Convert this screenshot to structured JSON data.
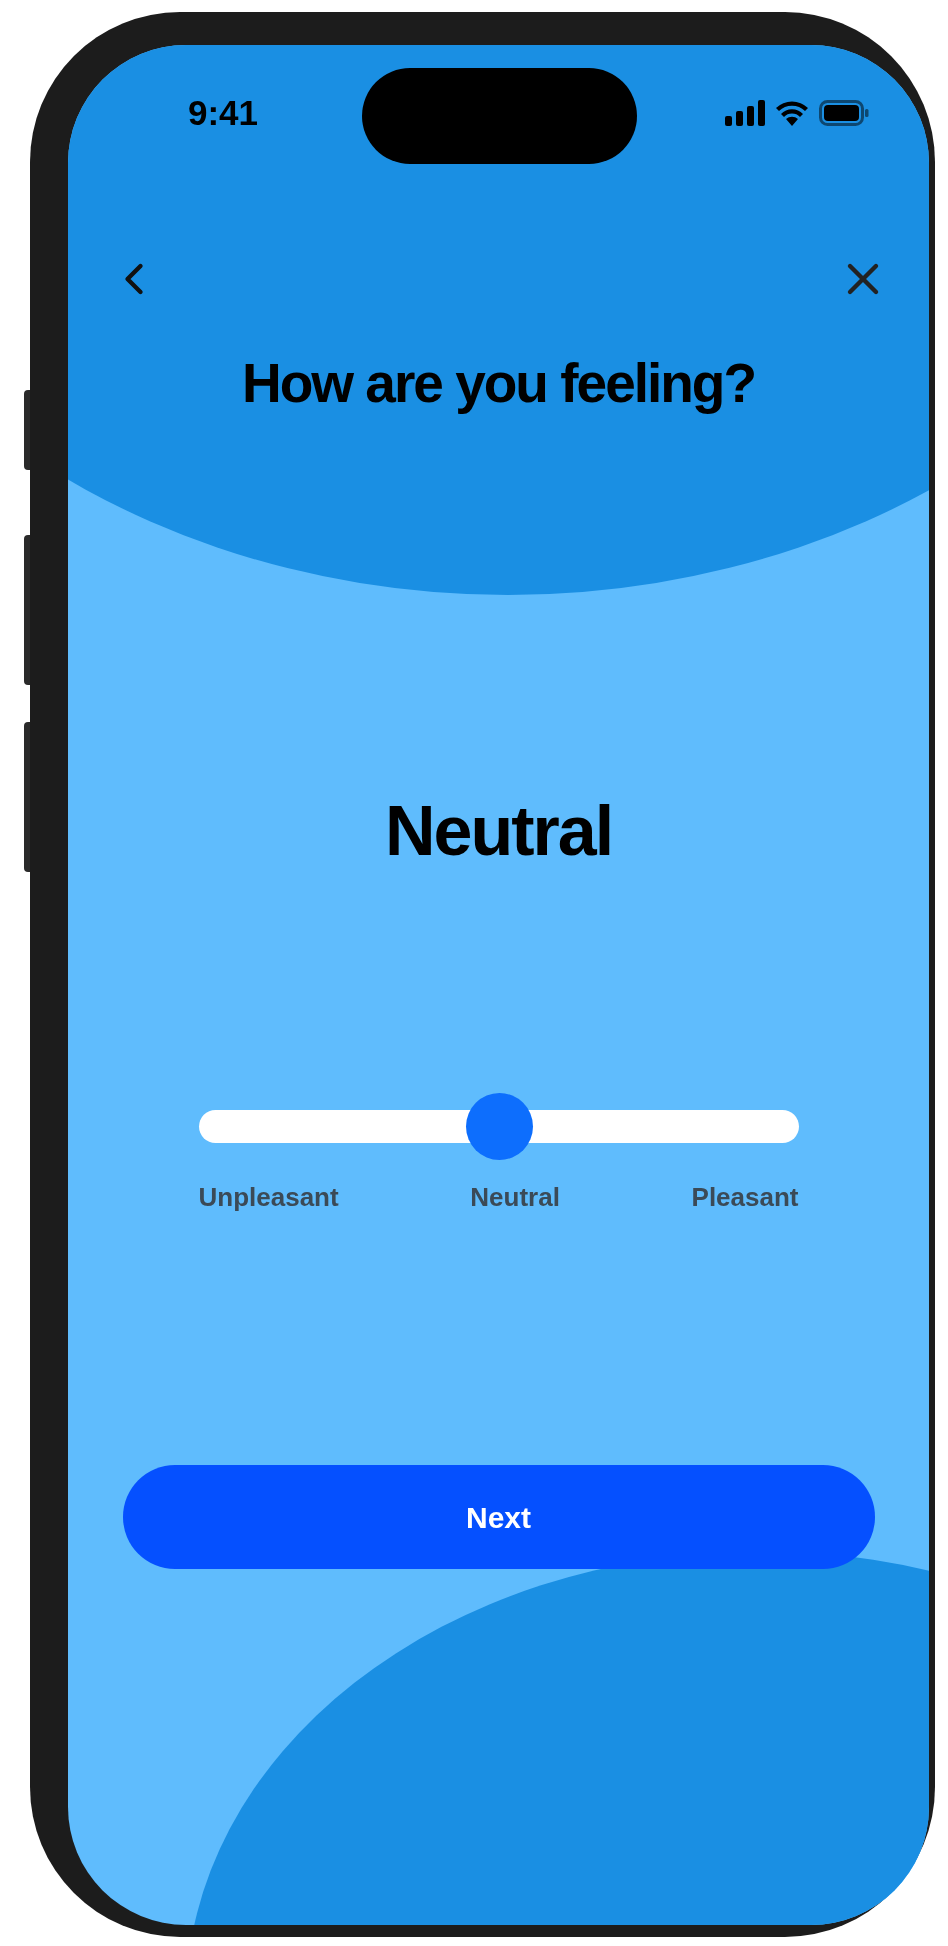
{
  "status_bar": {
    "time": "9:41"
  },
  "header": {
    "title": "How are you feeling?"
  },
  "mood": {
    "label": "Neutral"
  },
  "slider": {
    "level": 0.5,
    "labels": [
      "Unpleasant",
      "Neutral",
      "Pleasant"
    ]
  },
  "next_button": {
    "label": "Next"
  }
}
